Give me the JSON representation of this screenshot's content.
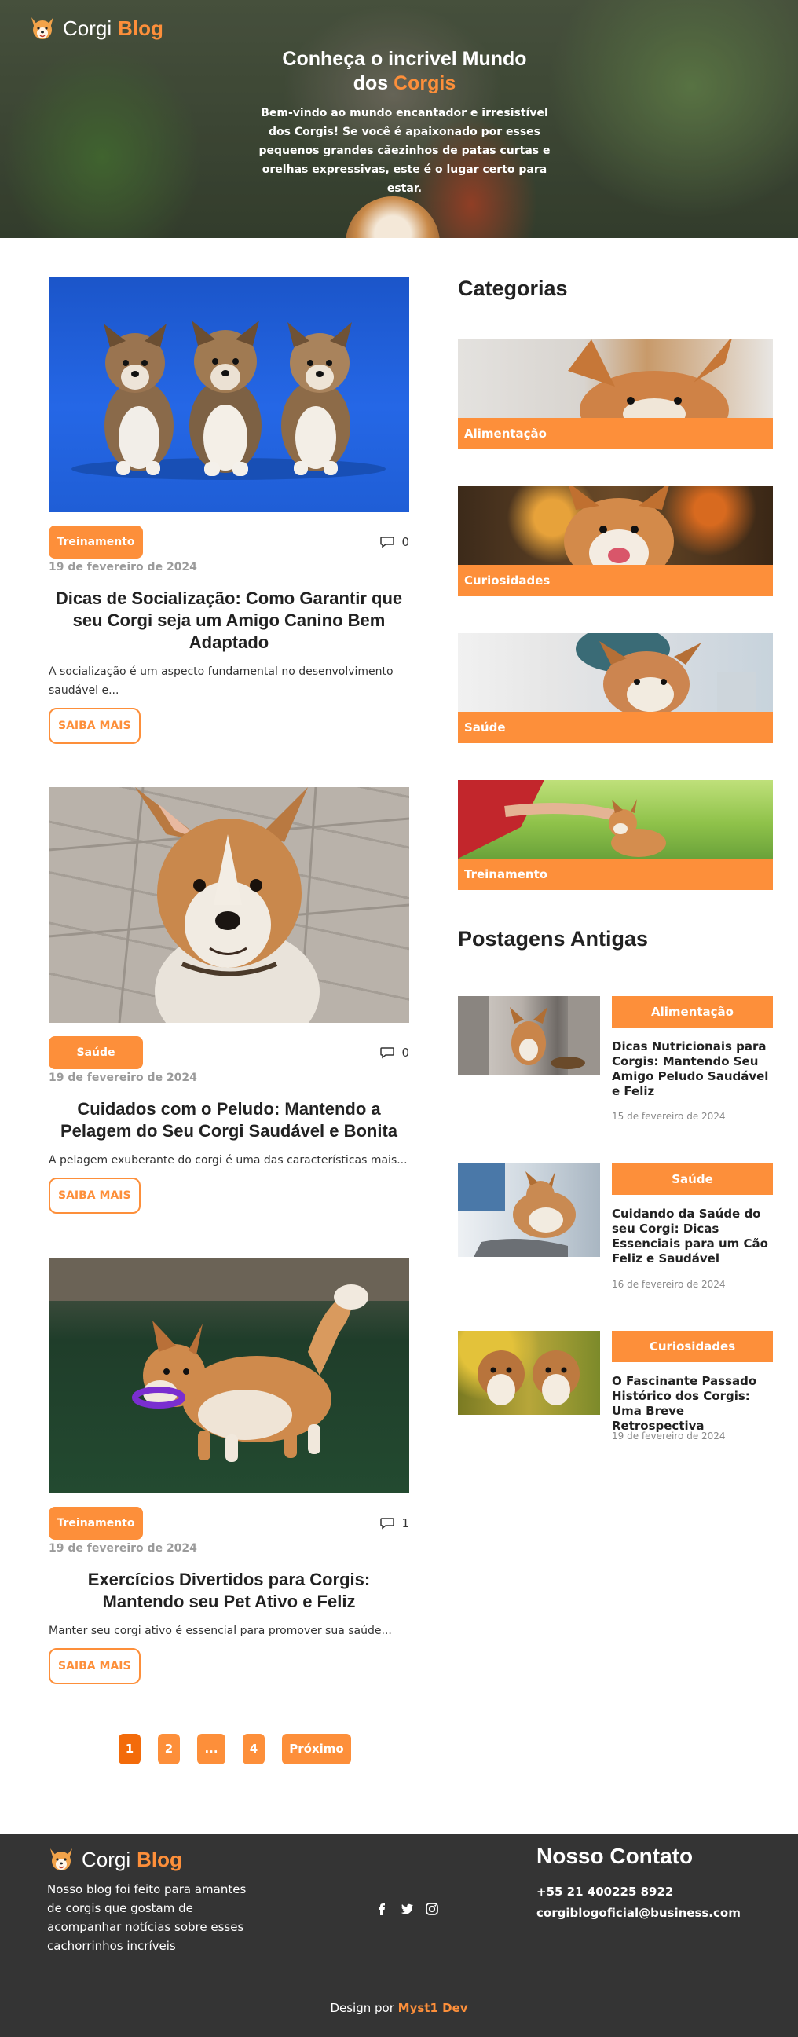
{
  "brand": {
    "name_part1": "Corgi",
    "name_part2": "Blog"
  },
  "hero": {
    "title_line1": "Conheça o incrivel Mundo",
    "title_line2_prefix": "dos",
    "title_line2_accent": "Corgis",
    "description": "Bem-vindo ao mundo encantador e irresistível dos Corgis! Se você é apaixonado por esses pequenos grandes cãezinhos de patas curtas e orelhas expressivas, este é o lugar certo para estar."
  },
  "posts": [
    {
      "category": "Treinamento",
      "comments": "0",
      "date": "19 de fevereiro de 2024",
      "title": "Dicas de Socialização: Como Garantir que seu Corgi seja um Amigo Canino Bem Adaptado",
      "excerpt": "A socialização é um aspecto fundamental no desenvolvimento saudável e...",
      "cta": "SAIBA MAIS"
    },
    {
      "category": "Saúde",
      "comments": "0",
      "date": "19 de fevereiro de 2024",
      "title": "Cuidados com o Peludo: Mantendo a Pelagem do Seu Corgi Saudável e Bonita",
      "excerpt": "A pelagem exuberante do corgi é uma das características mais...",
      "cta": "SAIBA MAIS"
    },
    {
      "category": "Treinamento",
      "comments": "1",
      "date": "19 de fevereiro de 2024",
      "title": "Exercícios Divertidos para Corgis: Mantendo seu Pet Ativo e Feliz",
      "excerpt": "Manter seu corgi ativo é essencial para promover sua saúde...",
      "cta": "SAIBA MAIS"
    }
  ],
  "pagination": {
    "pages": [
      "1",
      "2",
      "...",
      "4"
    ],
    "next": "Próximo",
    "active": "1"
  },
  "sidebar": {
    "categories_heading": "Categorias",
    "categories": [
      "Alimentação",
      "Curiosidades",
      "Saúde",
      "Treinamento"
    ],
    "old_posts_heading": "Postagens Antigas",
    "old_posts": [
      {
        "category": "Alimentação",
        "title": "Dicas Nutricionais para Corgis: Mantendo Seu Amigo Peludo Saudável e Feliz",
        "date": "15 de fevereiro de 2024"
      },
      {
        "category": "Saúde",
        "title": "Cuidando da Saúde do seu Corgi: Dicas Essenciais para um Cão Feliz e Saudável",
        "date": "16 de fevereiro de 2024"
      },
      {
        "category": "Curiosidades",
        "title": "O Fascinante Passado Histórico dos Corgis: Uma Breve Retrospectiva",
        "date": "19 de fevereiro de 2024"
      }
    ]
  },
  "footer": {
    "description": "Nosso blog foi feito para amantes de corgis que gostam de acompanhar notícias sobre esses cachorrinhos incríveis",
    "social_icons": [
      "facebook-icon",
      "twitter-icon",
      "instagram-icon"
    ],
    "contact_heading": "Nosso Contato",
    "phone": "+55 21 400225 8922",
    "email": "corgiblogoficial@business.com",
    "credit_prefix": "Design por",
    "credit_name": "Myst1 Dev"
  },
  "colors": {
    "accent": "#fd8f3a",
    "accent_active": "#f36b0a",
    "footer_bg": "#343434"
  }
}
